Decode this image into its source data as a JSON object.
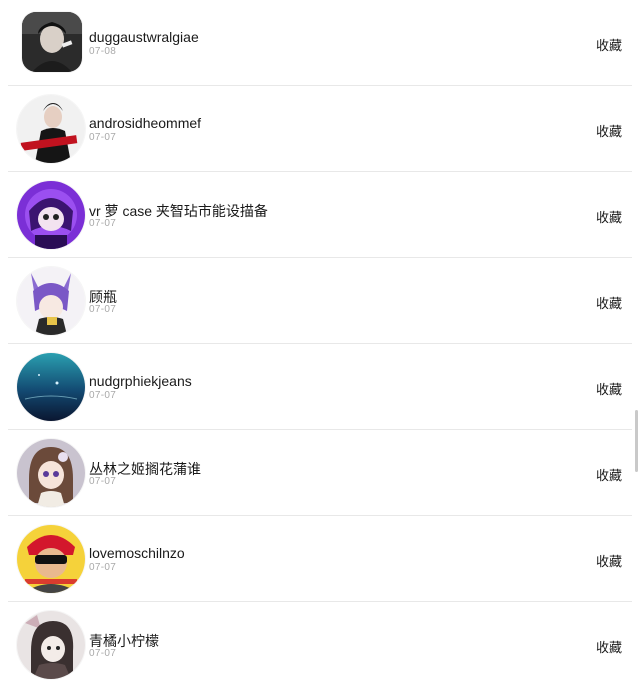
{
  "fav_label": "收藏",
  "items": [
    {
      "name": "duggaustwralgiae",
      "date": "07-08",
      "avatar": "dark-portrait"
    },
    {
      "name": "androsidheommef",
      "date": "07-07",
      "avatar": "fashion-portrait"
    },
    {
      "name": "vr 萝 case 夹智玷市能设描备",
      "date": "07-07",
      "avatar": "purple-anime"
    },
    {
      "name": "顾瓶",
      "date": "07-07",
      "avatar": "catgirl-anime"
    },
    {
      "name": "nudgrphiekjeans",
      "date": "07-07",
      "avatar": "underwater"
    },
    {
      "name": "丛林之姬搁花蒲谁",
      "date": "07-07",
      "avatar": "anime-girl"
    },
    {
      "name": "lovemoschilnzo",
      "date": "07-07",
      "avatar": "sunglasses-man"
    },
    {
      "name": "青橘小柠檬",
      "date": "07-07",
      "avatar": "sketch-girl"
    }
  ]
}
